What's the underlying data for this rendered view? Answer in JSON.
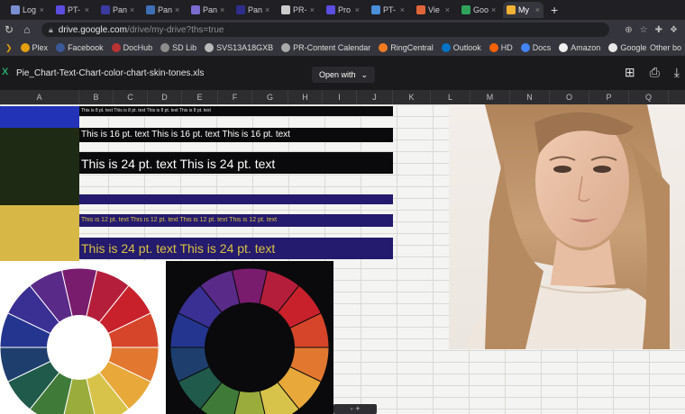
{
  "browser": {
    "tabs": [
      {
        "label": "Log",
        "color": "#7a8fd1"
      },
      {
        "label": "PT-",
        "color": "#5b4de0"
      },
      {
        "label": "Pan",
        "color": "#3a3aa0"
      },
      {
        "label": "Pan",
        "color": "#3d6fb5"
      },
      {
        "label": "Pan",
        "color": "#7a6cd0"
      },
      {
        "label": "Pan",
        "color": "#2e2e8a"
      },
      {
        "label": "PR-",
        "color": "#cccccc"
      },
      {
        "label": "Pro",
        "color": "#5b4de0"
      },
      {
        "label": "PT-",
        "color": "#4a8fd8"
      },
      {
        "label": "Vie",
        "color": "#e0663a"
      },
      {
        "label": "Goo",
        "color": "#2fa35a"
      },
      {
        "label": "My",
        "color": "#f2b233",
        "active": true
      }
    ],
    "url_host": "drive.google.com",
    "url_path": "/drive/my-drive?ths=true",
    "bookmarks": [
      {
        "label": "Plex",
        "color": "#e5a00d"
      },
      {
        "label": "Facebook",
        "color": "#3b5998"
      },
      {
        "label": "DocHub",
        "color": "#b33"
      },
      {
        "label": "SD Lib",
        "color": "#8d8d8d"
      },
      {
        "label": "SVS13A18GXB",
        "color": "#bbbbbb"
      },
      {
        "label": "PR-Content Calendar",
        "color": "#aaaaaa"
      },
      {
        "label": "RingCentral",
        "color": "#f47c20"
      },
      {
        "label": "Outlook",
        "color": "#0072c6"
      },
      {
        "label": "HD",
        "color": "#f96302"
      },
      {
        "label": "Docs",
        "color": "#4285f4"
      },
      {
        "label": "Amazon",
        "color": "#f0f0f0"
      },
      {
        "label": "Google",
        "color": "#e8e8e8"
      }
    ],
    "other_bookmarks": "Other bo"
  },
  "viewer": {
    "filename": "Pie_Chart-Text-Chart-color-chart-skin-tones.xls",
    "open_with": "Open with"
  },
  "columns": [
    "A",
    "B",
    "C",
    "D",
    "E",
    "F",
    "G",
    "H",
    "I",
    "J",
    "K",
    "L",
    "M",
    "N",
    "O",
    "P",
    "Q"
  ],
  "sheet": {
    "rows": [
      {
        "text": "This is 8 pt. text   This is 8 pt. text   This is 8 pt. text   This is 8 pt. text",
        "color": "#e8e8e8"
      },
      {
        "text": "This is 16 pt. text   This is 16 pt. text   This is 16 pt. text",
        "color": "#ffffff"
      },
      {
        "text": "This is 24 pt. text    This is 24 pt. text",
        "color": "#ffffff"
      },
      {
        "text": "",
        "color": "#ffffff"
      },
      {
        "text": "This is 12 pt. text   This is 12 pt. text   This is 12 pt. text   This is 12 pt. text",
        "color": "#d9c241"
      },
      {
        "text": "This is 24 pt. text    This is 24 pt. text",
        "color": "#d9c241"
      }
    ],
    "swatches": [
      "#2233b8",
      "#1f2a14",
      "#d7b846"
    ],
    "wheel_colors": [
      "#7a1c6e",
      "#b51e3a",
      "#c8212c",
      "#d6452a",
      "#e2772f",
      "#e8a83a",
      "#d8c34a",
      "#9aac3c",
      "#3f7a38",
      "#1f5a4a",
      "#1e3e6e",
      "#23358f",
      "#3a2f93",
      "#5a2a88"
    ]
  },
  "popup": {
    "label": "◦   +"
  }
}
